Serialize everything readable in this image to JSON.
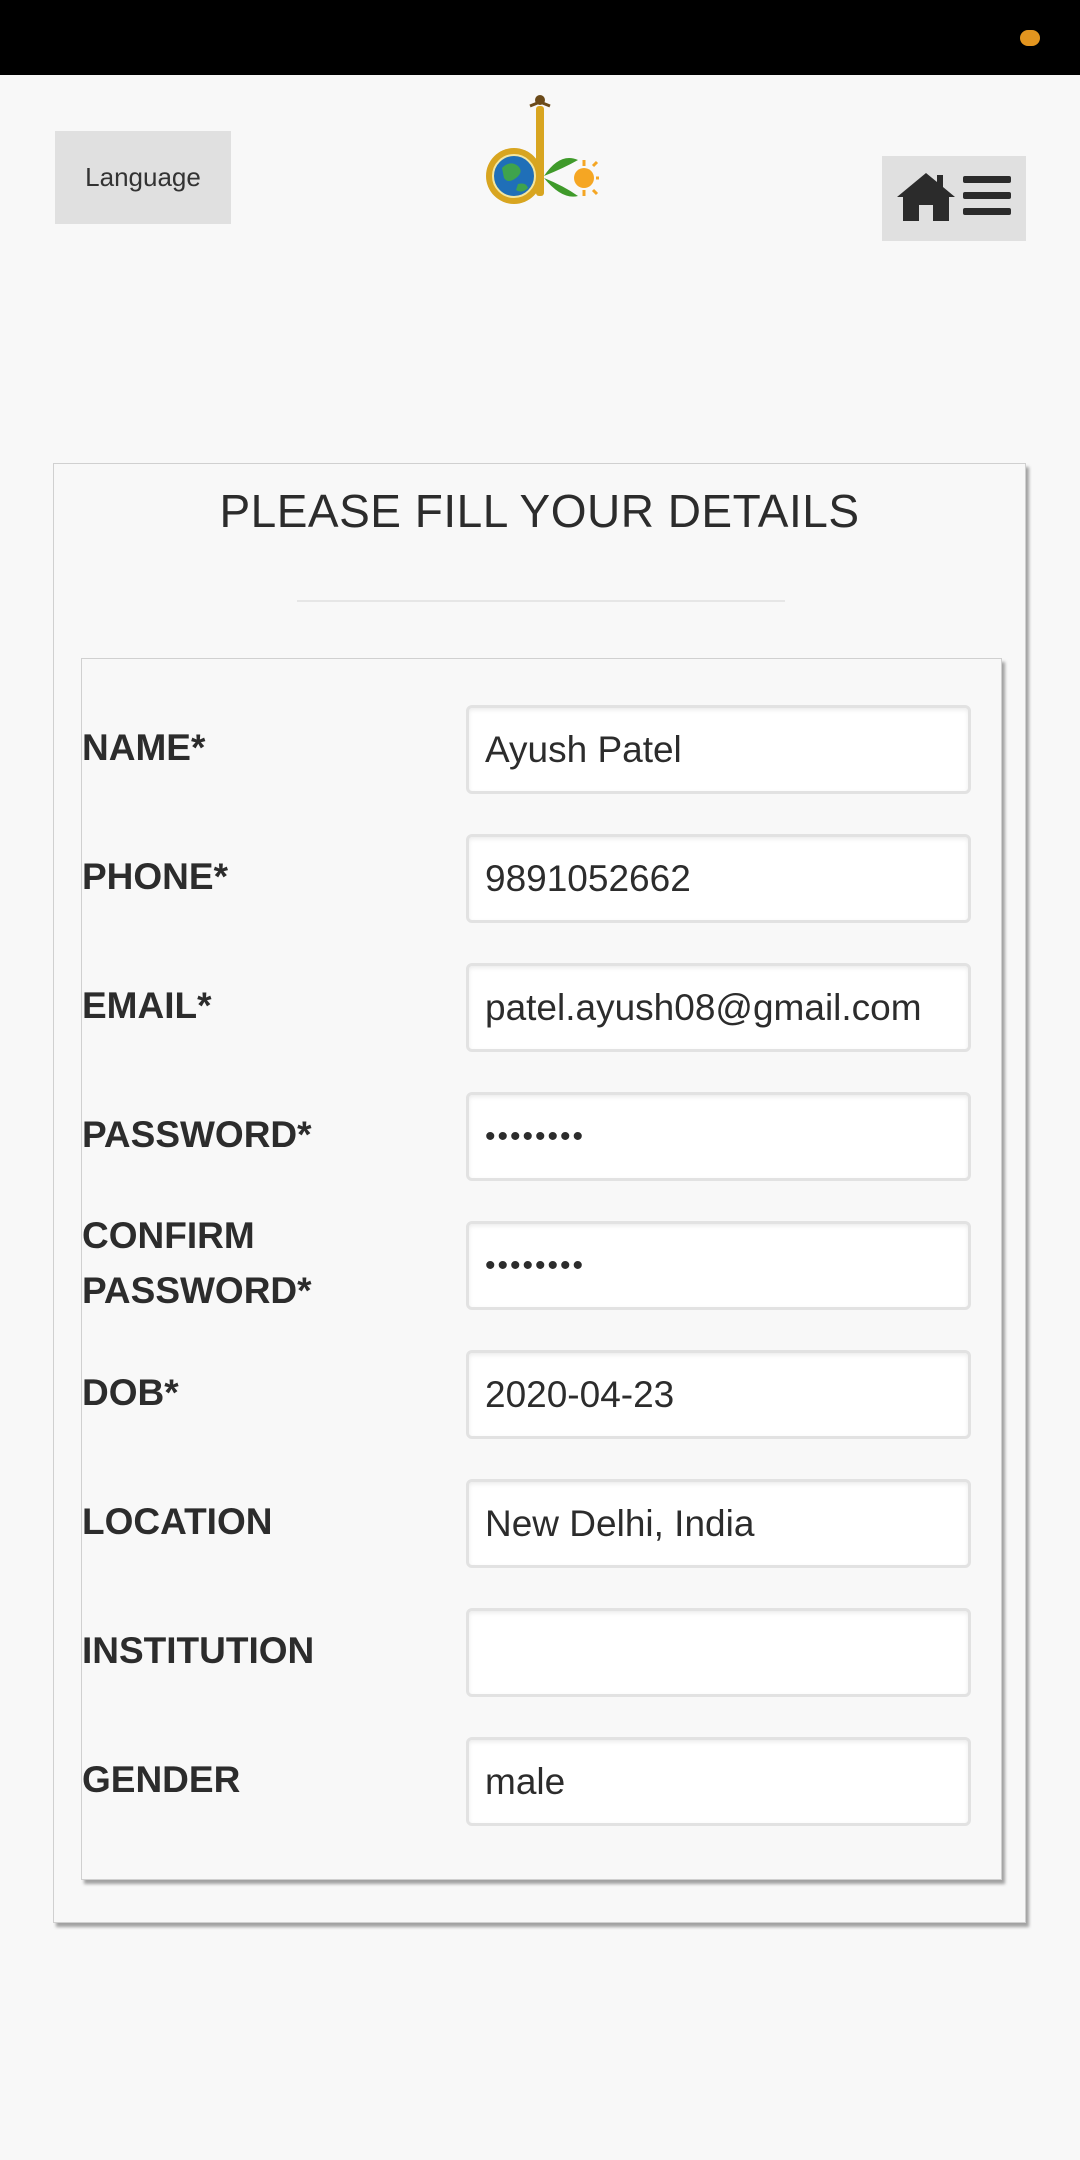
{
  "header": {
    "language_label": "Language",
    "logo_icon": "dk-logo-icon",
    "home_icon": "home-icon",
    "menu_icon": "hamburger-menu-icon"
  },
  "form": {
    "title": "PLEASE FILL YOUR DETAILS",
    "fields": [
      {
        "label": "NAME*",
        "value": "Ayush Patel"
      },
      {
        "label": "PHONE*",
        "value": "9891052662"
      },
      {
        "label": "EMAIL*",
        "value": "patel.ayush08@gmail.com"
      },
      {
        "label": "PASSWORD*",
        "value": "••••••••"
      },
      {
        "label": "CONFIRM PASSWORD*",
        "value": "••••••••"
      },
      {
        "label": "DOB*",
        "value": "2020-04-23"
      },
      {
        "label": "LOCATION",
        "value": "New Delhi, India"
      },
      {
        "label": "INSTITUTION",
        "value": ""
      },
      {
        "label": "GENDER",
        "value": "male"
      }
    ]
  },
  "colors": {
    "status_bar": "#000000",
    "background": "#f8f8f8",
    "button_gray": "#e0e0e0",
    "logo_gold": "#d8a520",
    "logo_green": "#3f9a2a",
    "logo_orange": "#f5a623"
  }
}
